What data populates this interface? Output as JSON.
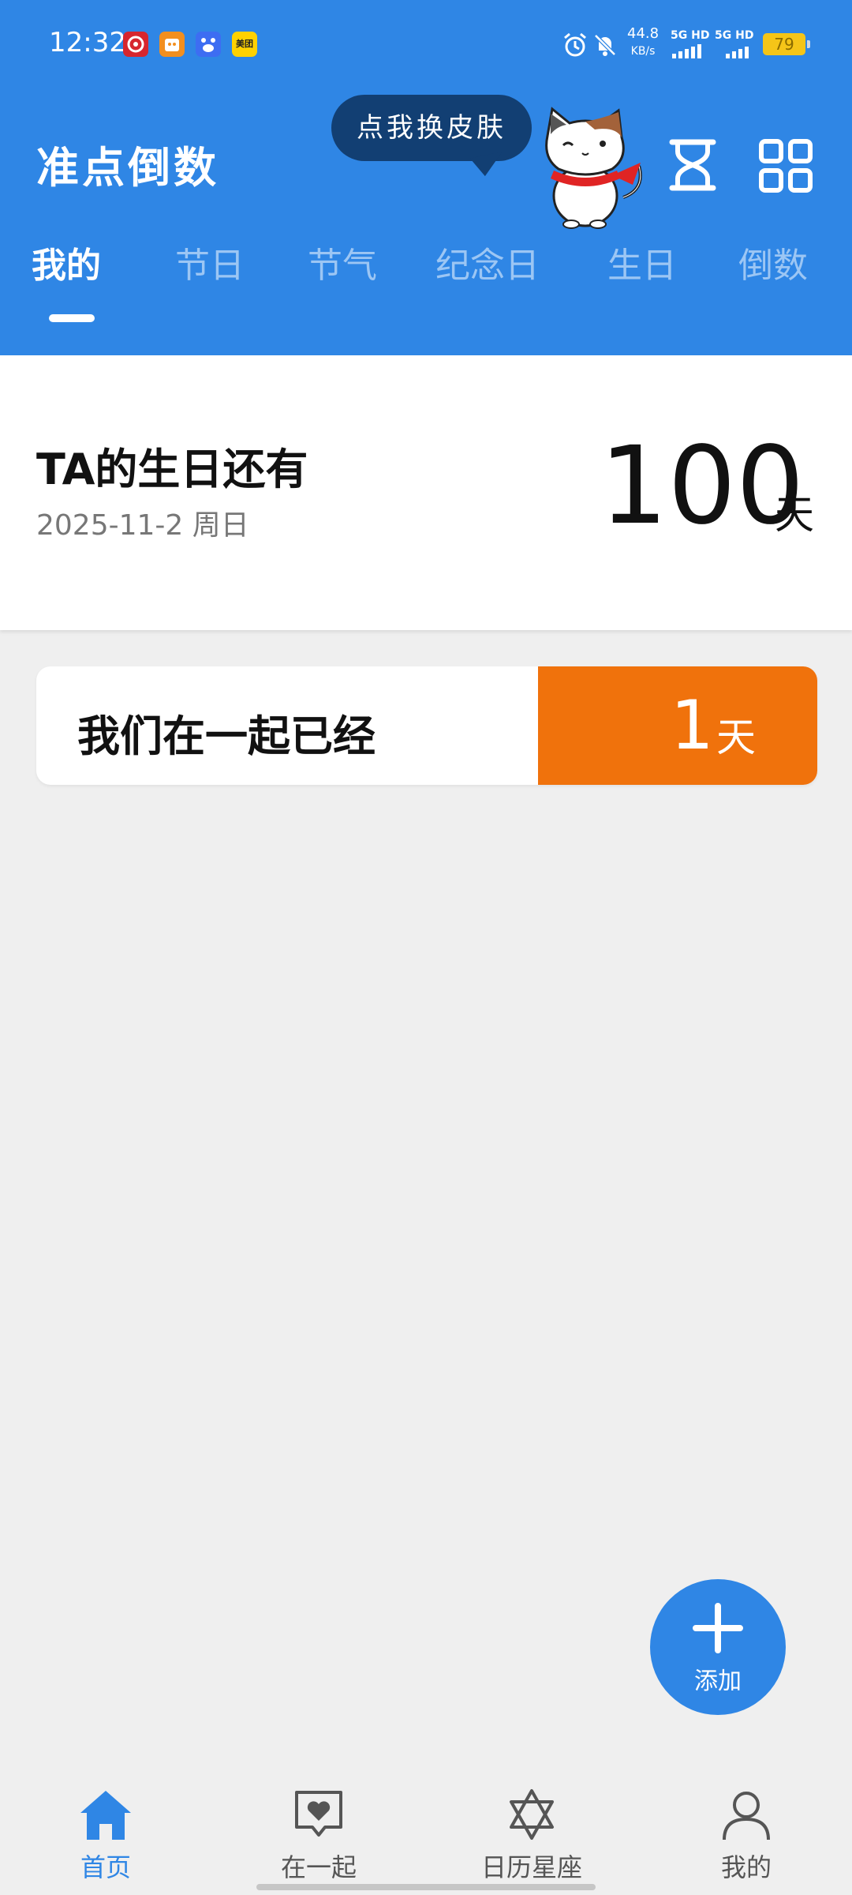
{
  "status_bar": {
    "time": "12:32",
    "net_speed_value": "44.8",
    "net_speed_unit": "KB/s",
    "sim1": "5G HD",
    "sim2": "5G HD",
    "battery": "79",
    "app_icons": [
      {
        "name": "netease-music",
        "color": "#d7262e"
      },
      {
        "name": "taobao-style",
        "color": "#f28f1f"
      },
      {
        "name": "baidu",
        "color": "#3d6df2"
      },
      {
        "name": "meituan",
        "color": "#ffd100",
        "text": "美团"
      }
    ]
  },
  "header": {
    "title": "准点倒数",
    "bubble_text": "点我换皮肤",
    "brand_color": "#2f86e5"
  },
  "tabs": [
    {
      "label": "我的",
      "active": true
    },
    {
      "label": "节日",
      "active": false
    },
    {
      "label": "节气",
      "active": false
    },
    {
      "label": "纪念日",
      "active": false
    },
    {
      "label": "生日",
      "active": false
    },
    {
      "label": "倒数",
      "active": false
    }
  ],
  "hero": {
    "label": "TA的生日还有",
    "date": "2025-11-2 周日",
    "days": "100",
    "unit": "天"
  },
  "events": [
    {
      "label": "我们在一起已经",
      "days": "1",
      "unit": "天",
      "accent": "#f0720c"
    }
  ],
  "fab": {
    "label": "添加"
  },
  "bottom_nav": [
    {
      "label": "首页",
      "icon": "home-icon",
      "active": true
    },
    {
      "label": "在一起",
      "icon": "heart-chat-icon",
      "active": false
    },
    {
      "label": "日历星座",
      "icon": "star-of-david-icon",
      "active": false
    },
    {
      "label": "我的",
      "icon": "profile-icon",
      "active": false
    }
  ]
}
